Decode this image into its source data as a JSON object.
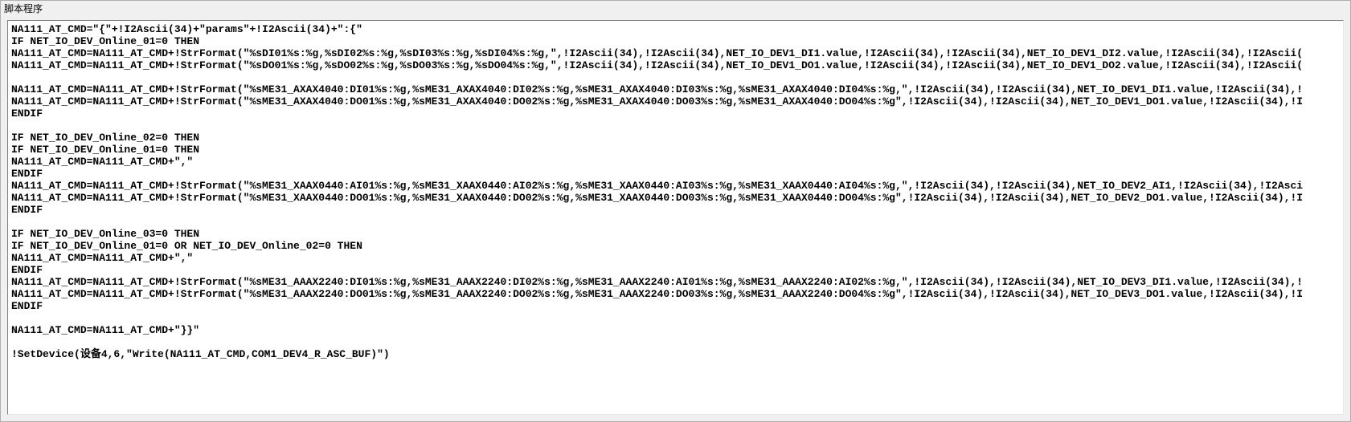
{
  "panel": {
    "title": "脚本程序"
  },
  "code": {
    "lines": [
      "NA111_AT_CMD=\"{\"+!I2Ascii(34)+\"params\"+!I2Ascii(34)+\":{\"",
      "IF NET_IO_DEV_Online_01=0 THEN",
      "NA111_AT_CMD=NA111_AT_CMD+!StrFormat(\"%sDI01%s:%g,%sDI02%s:%g,%sDI03%s:%g,%sDI04%s:%g,\",!I2Ascii(34),!I2Ascii(34),NET_IO_DEV1_DI1.value,!I2Ascii(34),!I2Ascii(34),NET_IO_DEV1_DI2.value,!I2Ascii(34),!I2Ascii(",
      "NA111_AT_CMD=NA111_AT_CMD+!StrFormat(\"%sDO01%s:%g,%sDO02%s:%g,%sDO03%s:%g,%sDO04%s:%g,\",!I2Ascii(34),!I2Ascii(34),NET_IO_DEV1_DO1.value,!I2Ascii(34),!I2Ascii(34),NET_IO_DEV1_DO2.value,!I2Ascii(34),!I2Ascii(",
      "",
      "NA111_AT_CMD=NA111_AT_CMD+!StrFormat(\"%sME31_AXAX4040:DI01%s:%g,%sME31_AXAX4040:DI02%s:%g,%sME31_AXAX4040:DI03%s:%g,%sME31_AXAX4040:DI04%s:%g,\",!I2Ascii(34),!I2Ascii(34),NET_IO_DEV1_DI1.value,!I2Ascii(34),!",
      "NA111_AT_CMD=NA111_AT_CMD+!StrFormat(\"%sME31_AXAX4040:DO01%s:%g,%sME31_AXAX4040:DO02%s:%g,%sME31_AXAX4040:DO03%s:%g,%sME31_AXAX4040:DO04%s:%g\",!I2Ascii(34),!I2Ascii(34),NET_IO_DEV1_DO1.value,!I2Ascii(34),!I",
      "ENDIF",
      "",
      "IF NET_IO_DEV_Online_02=0 THEN",
      "IF NET_IO_DEV_Online_01=0 THEN",
      "NA111_AT_CMD=NA111_AT_CMD+\",\"",
      "ENDIF",
      "NA111_AT_CMD=NA111_AT_CMD+!StrFormat(\"%sME31_XAAX0440:AI01%s:%g,%sME31_XAAX0440:AI02%s:%g,%sME31_XAAX0440:AI03%s:%g,%sME31_XAAX0440:AI04%s:%g,\",!I2Ascii(34),!I2Ascii(34),NET_IO_DEV2_AI1,!I2Ascii(34),!I2Asci",
      "NA111_AT_CMD=NA111_AT_CMD+!StrFormat(\"%sME31_XAAX0440:DO01%s:%g,%sME31_XAAX0440:DO02%s:%g,%sME31_XAAX0440:DO03%s:%g,%sME31_XAAX0440:DO04%s:%g\",!I2Ascii(34),!I2Ascii(34),NET_IO_DEV2_DO1.value,!I2Ascii(34),!I",
      "ENDIF",
      "",
      "IF NET_IO_DEV_Online_03=0 THEN",
      "IF NET_IO_DEV_Online_01=0 OR NET_IO_DEV_Online_02=0 THEN",
      "NA111_AT_CMD=NA111_AT_CMD+\",\"",
      "ENDIF",
      "NA111_AT_CMD=NA111_AT_CMD+!StrFormat(\"%sME31_AAAX2240:DI01%s:%g,%sME31_AAAX2240:DI02%s:%g,%sME31_AAAX2240:AI01%s:%g,%sME31_AAAX2240:AI02%s:%g,\",!I2Ascii(34),!I2Ascii(34),NET_IO_DEV3_DI1.value,!I2Ascii(34),!",
      "NA111_AT_CMD=NA111_AT_CMD+!StrFormat(\"%sME31_AAAX2240:DO01%s:%g,%sME31_AAAX2240:DO02%s:%g,%sME31_AAAX2240:DO03%s:%g,%sME31_AAAX2240:DO04%s:%g\",!I2Ascii(34),!I2Ascii(34),NET_IO_DEV3_DO1.value,!I2Ascii(34),!I",
      "ENDIF",
      "",
      "NA111_AT_CMD=NA111_AT_CMD+\"}}\"",
      "",
      "!SetDevice(设备4,6,\"Write(NA111_AT_CMD,COM1_DEV4_R_ASC_BUF)\")"
    ]
  }
}
